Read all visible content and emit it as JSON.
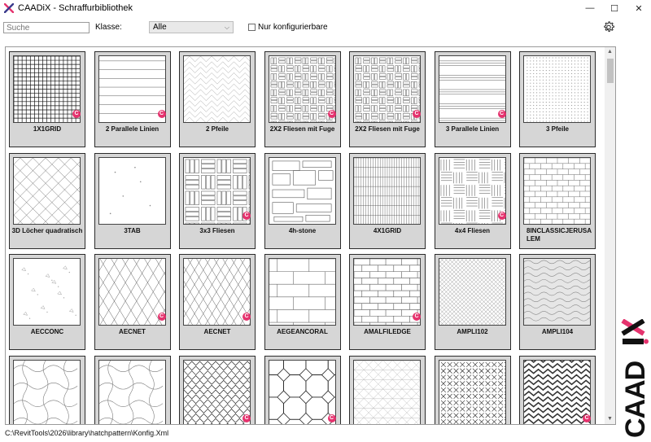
{
  "window": {
    "title": "CAADiX - Schraffurbibliothek",
    "minimize": "—",
    "maximize": "☐",
    "close": "✕"
  },
  "toolbar": {
    "search_placeholder": "Suche",
    "klasse_label": "Klasse:",
    "klasse_value": "Alle",
    "only_configurable_label": "Nur konfigurierbare",
    "only_configurable_checked": false
  },
  "library": {
    "badge_glyph": "C",
    "tiles": [
      {
        "name": "1X1GRID",
        "badge": true,
        "pattern": "grid"
      },
      {
        "name": "2 Parallele Linien",
        "badge": true,
        "pattern": "hlines-wide"
      },
      {
        "name": "2 Pfeile",
        "badge": false,
        "pattern": "arrows"
      },
      {
        "name": "2X2 Fliesen mit Fuge",
        "badge": true,
        "pattern": "tiles-fuge"
      },
      {
        "name": "2X2 Fliesen mit Fuge",
        "badge": true,
        "pattern": "tiles-fuge"
      },
      {
        "name": "3 Parallele Linien",
        "badge": true,
        "pattern": "hlines-triple"
      },
      {
        "name": "3 Pfeile",
        "badge": false,
        "pattern": "fine-dots"
      },
      {
        "name": "3D Löcher quadratisch",
        "badge": false,
        "pattern": "diamonds"
      },
      {
        "name": "3TAB",
        "badge": false,
        "pattern": "sparse-dots"
      },
      {
        "name": "3x3 Fliesen",
        "badge": true,
        "pattern": "parquet"
      },
      {
        "name": "4h-stone",
        "badge": false,
        "pattern": "stone"
      },
      {
        "name": "4X1GRID",
        "badge": false,
        "pattern": "fine-grid"
      },
      {
        "name": "4x4 Fliesen",
        "badge": true,
        "pattern": "basket"
      },
      {
        "name": "8INCLASSICJERUSALEM",
        "badge": false,
        "pattern": "bricks-small"
      },
      {
        "name": "AECCONC",
        "badge": false,
        "pattern": "concrete"
      },
      {
        "name": "AECNET",
        "badge": true,
        "pattern": "diag-net"
      },
      {
        "name": "AECNET",
        "badge": true,
        "pattern": "diag-net2"
      },
      {
        "name": "AEGEANCORAL",
        "badge": false,
        "pattern": "coral"
      },
      {
        "name": "AMALFILEDGE",
        "badge": true,
        "pattern": "bricks"
      },
      {
        "name": "AMPLI102",
        "badge": false,
        "pattern": "crosshatch"
      },
      {
        "name": "AMPLI104",
        "badge": false,
        "pattern": "waves-grey"
      },
      {
        "name": "",
        "badge": false,
        "pattern": "puzzle"
      },
      {
        "name": "",
        "badge": false,
        "pattern": "puzzle2"
      },
      {
        "name": "",
        "badge": true,
        "pattern": "scales"
      },
      {
        "name": "",
        "badge": true,
        "pattern": "octagon"
      },
      {
        "name": "",
        "badge": false,
        "pattern": "diag-light"
      },
      {
        "name": "",
        "badge": false,
        "pattern": "xcross"
      },
      {
        "name": "",
        "badge": true,
        "pattern": "chevron"
      }
    ]
  },
  "status": {
    "path": "C:\\RevitTools\\2026\\library\\hatchpattern\\Konfig.Xml"
  },
  "brand": {
    "text": "CAADIX",
    "accent_color": "#e5336e"
  },
  "icons": {
    "settings": "gear-icon",
    "app": "caadix-logo-icon"
  }
}
